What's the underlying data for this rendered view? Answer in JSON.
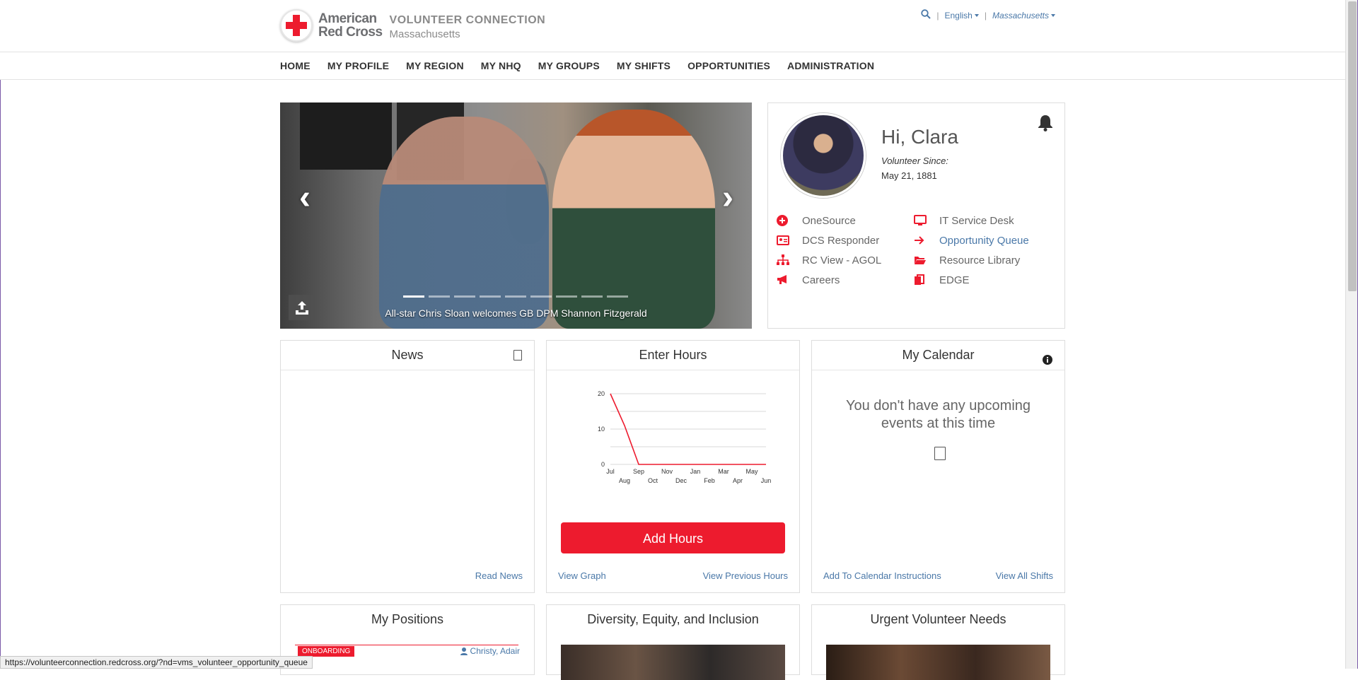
{
  "brand": {
    "org_line1": "American",
    "org_line2": "Red Cross",
    "product": "VOLUNTEER CONNECTION",
    "region": "Massachusetts"
  },
  "topbar": {
    "language": "English",
    "state": "Massachusetts"
  },
  "nav": {
    "items": [
      "HOME",
      "MY PROFILE",
      "MY REGION",
      "MY NHQ",
      "MY GROUPS",
      "MY SHIFTS",
      "OPPORTUNITIES",
      "ADMINISTRATION"
    ]
  },
  "carousel": {
    "caption": "All-star Chris Sloan welcomes GB DPM Shannon Fitzgerald",
    "slide_count": 9,
    "active_index": 0
  },
  "profile": {
    "greeting": "Hi, Clara",
    "since_label": "Volunteer Since:",
    "since_date": "May 21, 1881",
    "links": [
      {
        "label": "OneSource",
        "icon": "plus-circle-icon"
      },
      {
        "label": "IT Service Desk",
        "icon": "desktop-icon"
      },
      {
        "label": "DCS Responder",
        "icon": "id-card-icon"
      },
      {
        "label": "Opportunity Queue",
        "icon": "arrow-right-icon"
      },
      {
        "label": "RC View - AGOL",
        "icon": "sitemap-icon"
      },
      {
        "label": "Resource Library",
        "icon": "folder-open-icon"
      },
      {
        "label": "Careers",
        "icon": "megaphone-icon"
      },
      {
        "label": "EDGE",
        "icon": "copy-icon"
      }
    ]
  },
  "news": {
    "title": "News",
    "footer_link": "Read News"
  },
  "hours": {
    "title": "Enter Hours",
    "button": "Add Hours",
    "footer_left": "View Graph",
    "footer_right": "View Previous Hours"
  },
  "calendar": {
    "title": "My Calendar",
    "empty_message": "You don't have any upcoming events at this time",
    "footer_left": "Add To Calendar Instructions",
    "footer_right": "View All Shifts"
  },
  "positions": {
    "title": "My Positions",
    "badge": "ONBOARDING",
    "assignee": "Christy, Adair"
  },
  "dei": {
    "title": "Diversity, Equity, and Inclusion"
  },
  "urgent": {
    "title": "Urgent Volunteer Needs"
  },
  "status_url": "https://volunteerconnection.redcross.org/?nd=vms_volunteer_opportunity_queue",
  "colors": {
    "brand_red": "#ed1b2e",
    "link_blue": "#4a78a8"
  },
  "chart_data": {
    "type": "line",
    "x": [
      "Jul",
      "Aug",
      "Sep",
      "Oct",
      "Nov",
      "Dec",
      "Jan",
      "Feb",
      "Mar",
      "Apr",
      "May",
      "Jun"
    ],
    "series": [
      {
        "values": [
          20,
          11,
          0,
          0,
          0,
          0,
          0,
          0,
          0,
          0,
          0,
          0
        ]
      }
    ],
    "y_ticks": [
      0,
      10,
      20
    ],
    "ylim": [
      0,
      20
    ],
    "grid": true,
    "color": "#ed1b2e"
  }
}
